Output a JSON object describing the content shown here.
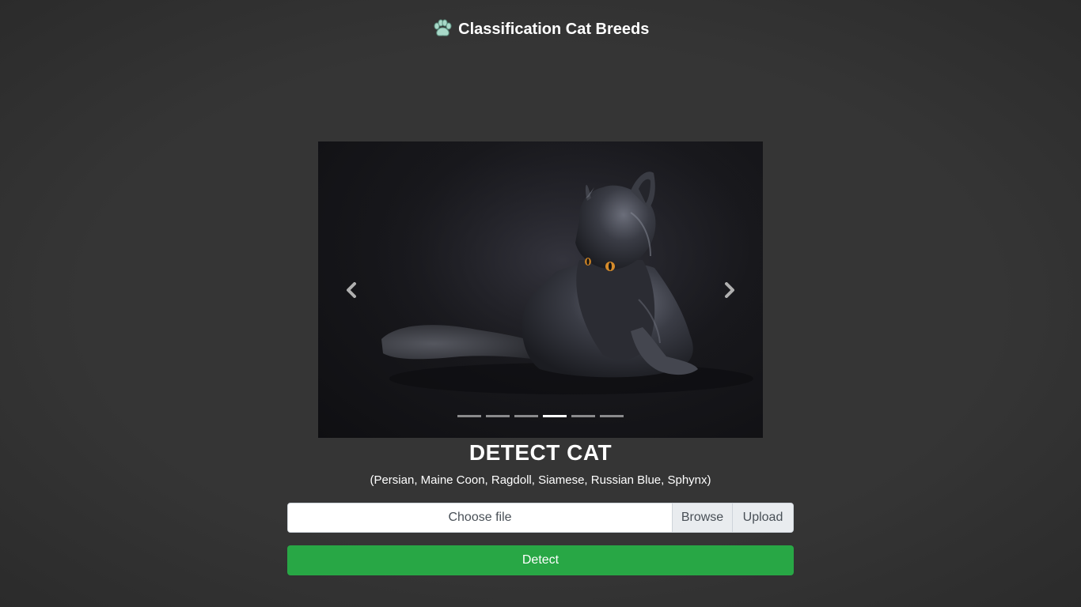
{
  "header": {
    "icon": "paw-icon",
    "title": "Classification Cat Breeds"
  },
  "carousel": {
    "image": "black-maine-coon-cat-photo",
    "prev_icon": "chevron-left-icon",
    "next_icon": "chevron-right-icon",
    "slide_count": 6,
    "active_index": 3
  },
  "main": {
    "title": "DETECT CAT",
    "subtitle": "(Persian, Maine Coon, Ragdoll, Siamese, Russian Blue, Sphynx)"
  },
  "upload": {
    "file_label": "Choose file",
    "browse_label": "Browse",
    "upload_label": "Upload"
  },
  "actions": {
    "detect_label": "Detect"
  },
  "colors": {
    "background": "#333333",
    "detect_button": "#28a745",
    "input_addon": "#e9ecef"
  }
}
